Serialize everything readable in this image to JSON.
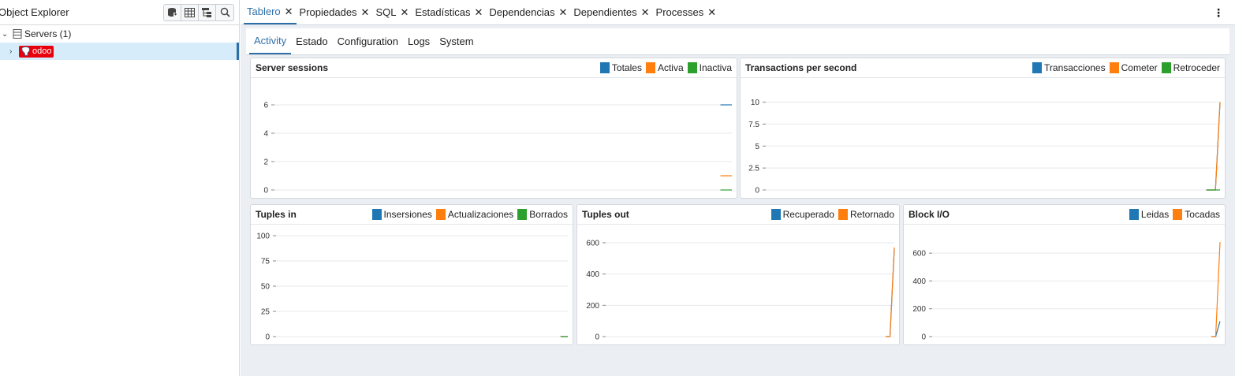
{
  "left_panel": {
    "title": "Object Explorer",
    "tools": [
      "db-icon",
      "table-icon",
      "tree-icon",
      "search-icon"
    ],
    "tree": {
      "servers_label": "Servers (1)",
      "server_label": "odoo"
    }
  },
  "tabs": [
    {
      "label": "Tablero",
      "active": true
    },
    {
      "label": "Propiedades"
    },
    {
      "label": "SQL"
    },
    {
      "label": "Estadísticas"
    },
    {
      "label": "Dependencias"
    },
    {
      "label": "Dependientes"
    },
    {
      "label": "Processes"
    }
  ],
  "menu_glyph": "⋮",
  "subtabs": [
    {
      "label": "Activity",
      "active": true
    },
    {
      "label": "Estado"
    },
    {
      "label": "Configuration"
    },
    {
      "label": "Logs"
    },
    {
      "label": "System"
    }
  ],
  "colors": {
    "blue": "#1f77b4",
    "orange": "#ff7f0e",
    "green": "#2ca02c",
    "accent": "#2f6fa8",
    "server_badge": "#e8000d"
  },
  "chart_data": [
    {
      "id": "sessions",
      "type": "line",
      "title": "Server sessions",
      "legend": [
        "Totales",
        "Activa",
        "Inactiva"
      ],
      "ylim": [
        0,
        6.5
      ],
      "yticks": [
        0,
        2,
        4,
        6
      ],
      "series": [
        {
          "name": "Totales",
          "values": [
            6,
            6
          ]
        },
        {
          "name": "Activa",
          "values": [
            1,
            1
          ]
        },
        {
          "name": "Inactiva",
          "values": [
            0,
            0
          ]
        }
      ]
    },
    {
      "id": "tps",
      "type": "line",
      "title": "Transactions per second",
      "legend": [
        "Transacciones",
        "Cometer",
        "Retroceder"
      ],
      "ylim": [
        0,
        10.5
      ],
      "yticks": [
        "0",
        "2.5",
        "5",
        "7.5",
        "10"
      ],
      "series": [
        {
          "name": "Transacciones",
          "values": [
            0,
            0,
            0,
            10
          ]
        },
        {
          "name": "Cometer",
          "values": [
            0,
            0,
            0,
            10
          ]
        },
        {
          "name": "Retroceder",
          "values": [
            0,
            0,
            0,
            0
          ]
        }
      ]
    },
    {
      "id": "tuples_in",
      "type": "line",
      "title": "Tuples in",
      "legend": [
        "Insersiones",
        "Actualizaciones",
        "Borrados"
      ],
      "ylim": [
        0,
        100
      ],
      "yticks": [
        0,
        25,
        50,
        75,
        100
      ],
      "series": [
        {
          "name": "Insersiones",
          "values": [
            0,
            0
          ]
        },
        {
          "name": "Actualizaciones",
          "values": [
            0,
            0
          ]
        },
        {
          "name": "Borrados",
          "values": [
            0,
            0
          ]
        }
      ]
    },
    {
      "id": "tuples_out",
      "type": "line",
      "title": "Tuples out",
      "legend": [
        "Recuperado",
        "Retornado"
      ],
      "ylim": [
        0,
        640
      ],
      "yticks": [
        0,
        200,
        400,
        600
      ],
      "series": [
        {
          "name": "Recuperado",
          "values": [
            0,
            0,
            560
          ]
        },
        {
          "name": "Retornado",
          "values": [
            0,
            0,
            570
          ]
        }
      ]
    },
    {
      "id": "block_io",
      "type": "line",
      "title": "Block I/O",
      "legend": [
        "Leidas",
        "Tocadas"
      ],
      "ylim": [
        0,
        720
      ],
      "yticks": [
        0,
        200,
        400,
        600
      ],
      "series": [
        {
          "name": "Leidas",
          "values": [
            0,
            0,
            110
          ]
        },
        {
          "name": "Tocadas",
          "values": [
            0,
            0,
            680
          ]
        }
      ]
    }
  ]
}
